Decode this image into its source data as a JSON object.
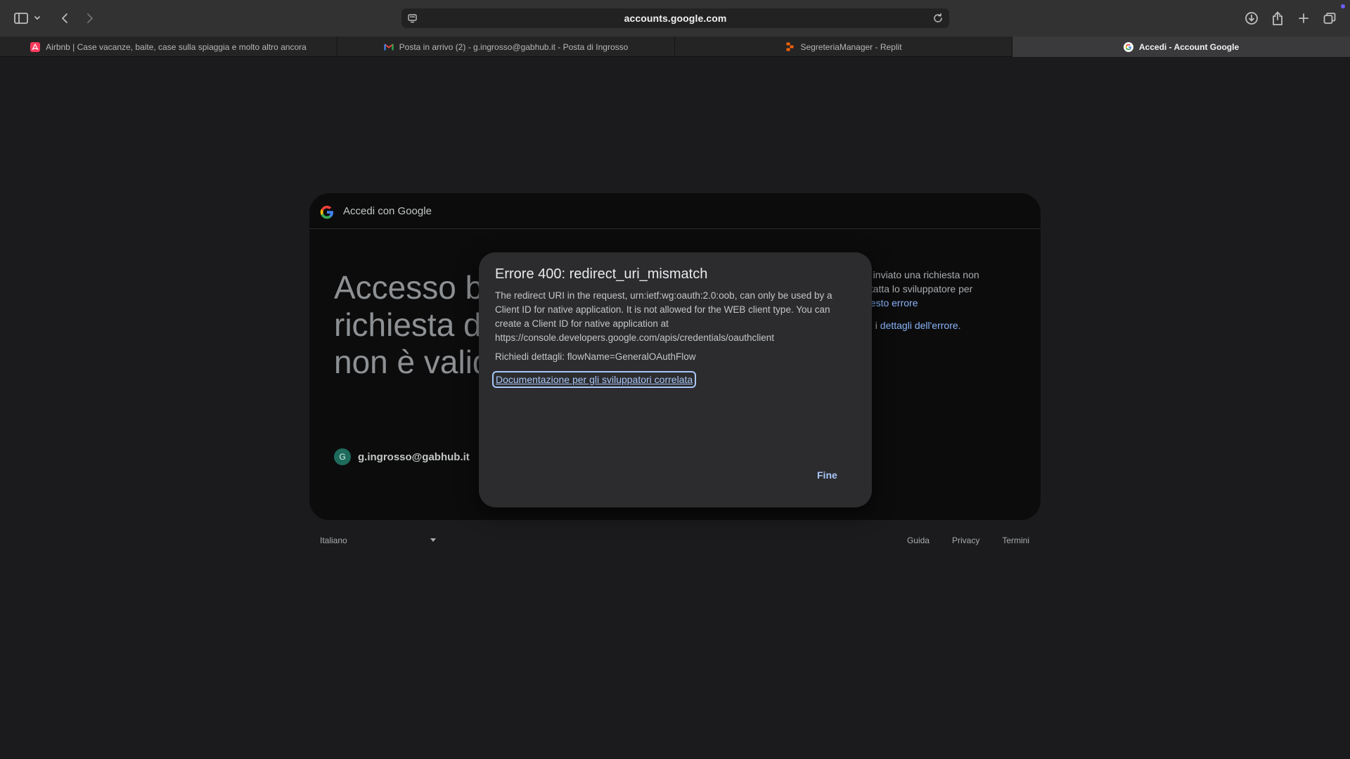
{
  "browser": {
    "address": "accounts.google.com",
    "tabs": [
      {
        "label": "Airbnb | Case vacanze, baite, case sulla spiaggia e molto altro ancora",
        "icon": "airbnb-icon",
        "active": false
      },
      {
        "label": "Posta in arrivo (2) - g.ingrosso@gabhub.it - Posta di Ingrosso",
        "icon": "gmail-icon",
        "active": false
      },
      {
        "label": "SegreteriaManager - Replit",
        "icon": "replit-icon",
        "active": false
      },
      {
        "label": "Accedi - Account Google",
        "icon": "google-icon",
        "active": true
      }
    ]
  },
  "card": {
    "header": "Accedi con Google",
    "headline_lines": [
      "Accesso b",
      "richiesta d",
      "non è valid"
    ],
    "account_initial": "G",
    "account_email": "g.ingrosso@gabhub.it",
    "right_line1": "a inviato una richiesta non",
    "right_line2": "ntatta lo sviluppatore per",
    "right_link1": "uesto errore",
    "right_prefix2": "di i ",
    "right_link2": "dettagli dell'errore."
  },
  "footer": {
    "language": "Italiano",
    "links": [
      "Guida",
      "Privacy",
      "Termini"
    ]
  },
  "dialog": {
    "title": "Errore 400: redirect_uri_mismatch",
    "body_lines": [
      "The redirect URI in the request, urn:ietf:wg:oauth:2.0:oob, can only be used by a",
      "Client ID for native application. It is not allowed for the WEB client type. You can",
      "create a Client ID for native application at",
      "https://console.developers.google.com/apis/credentials/oauthclient"
    ],
    "details": "Richiedi dettagli: flowName=GeneralOAuthFlow",
    "doc_link": "Documentazione per gli sviluppatori correlata",
    "done": "Fine"
  },
  "colors": {
    "link": "#a8c7fa",
    "page_bg": "#1b1b1d",
    "card_bg": "#0c0c0d",
    "dialog_bg": "#2c2c2e"
  }
}
